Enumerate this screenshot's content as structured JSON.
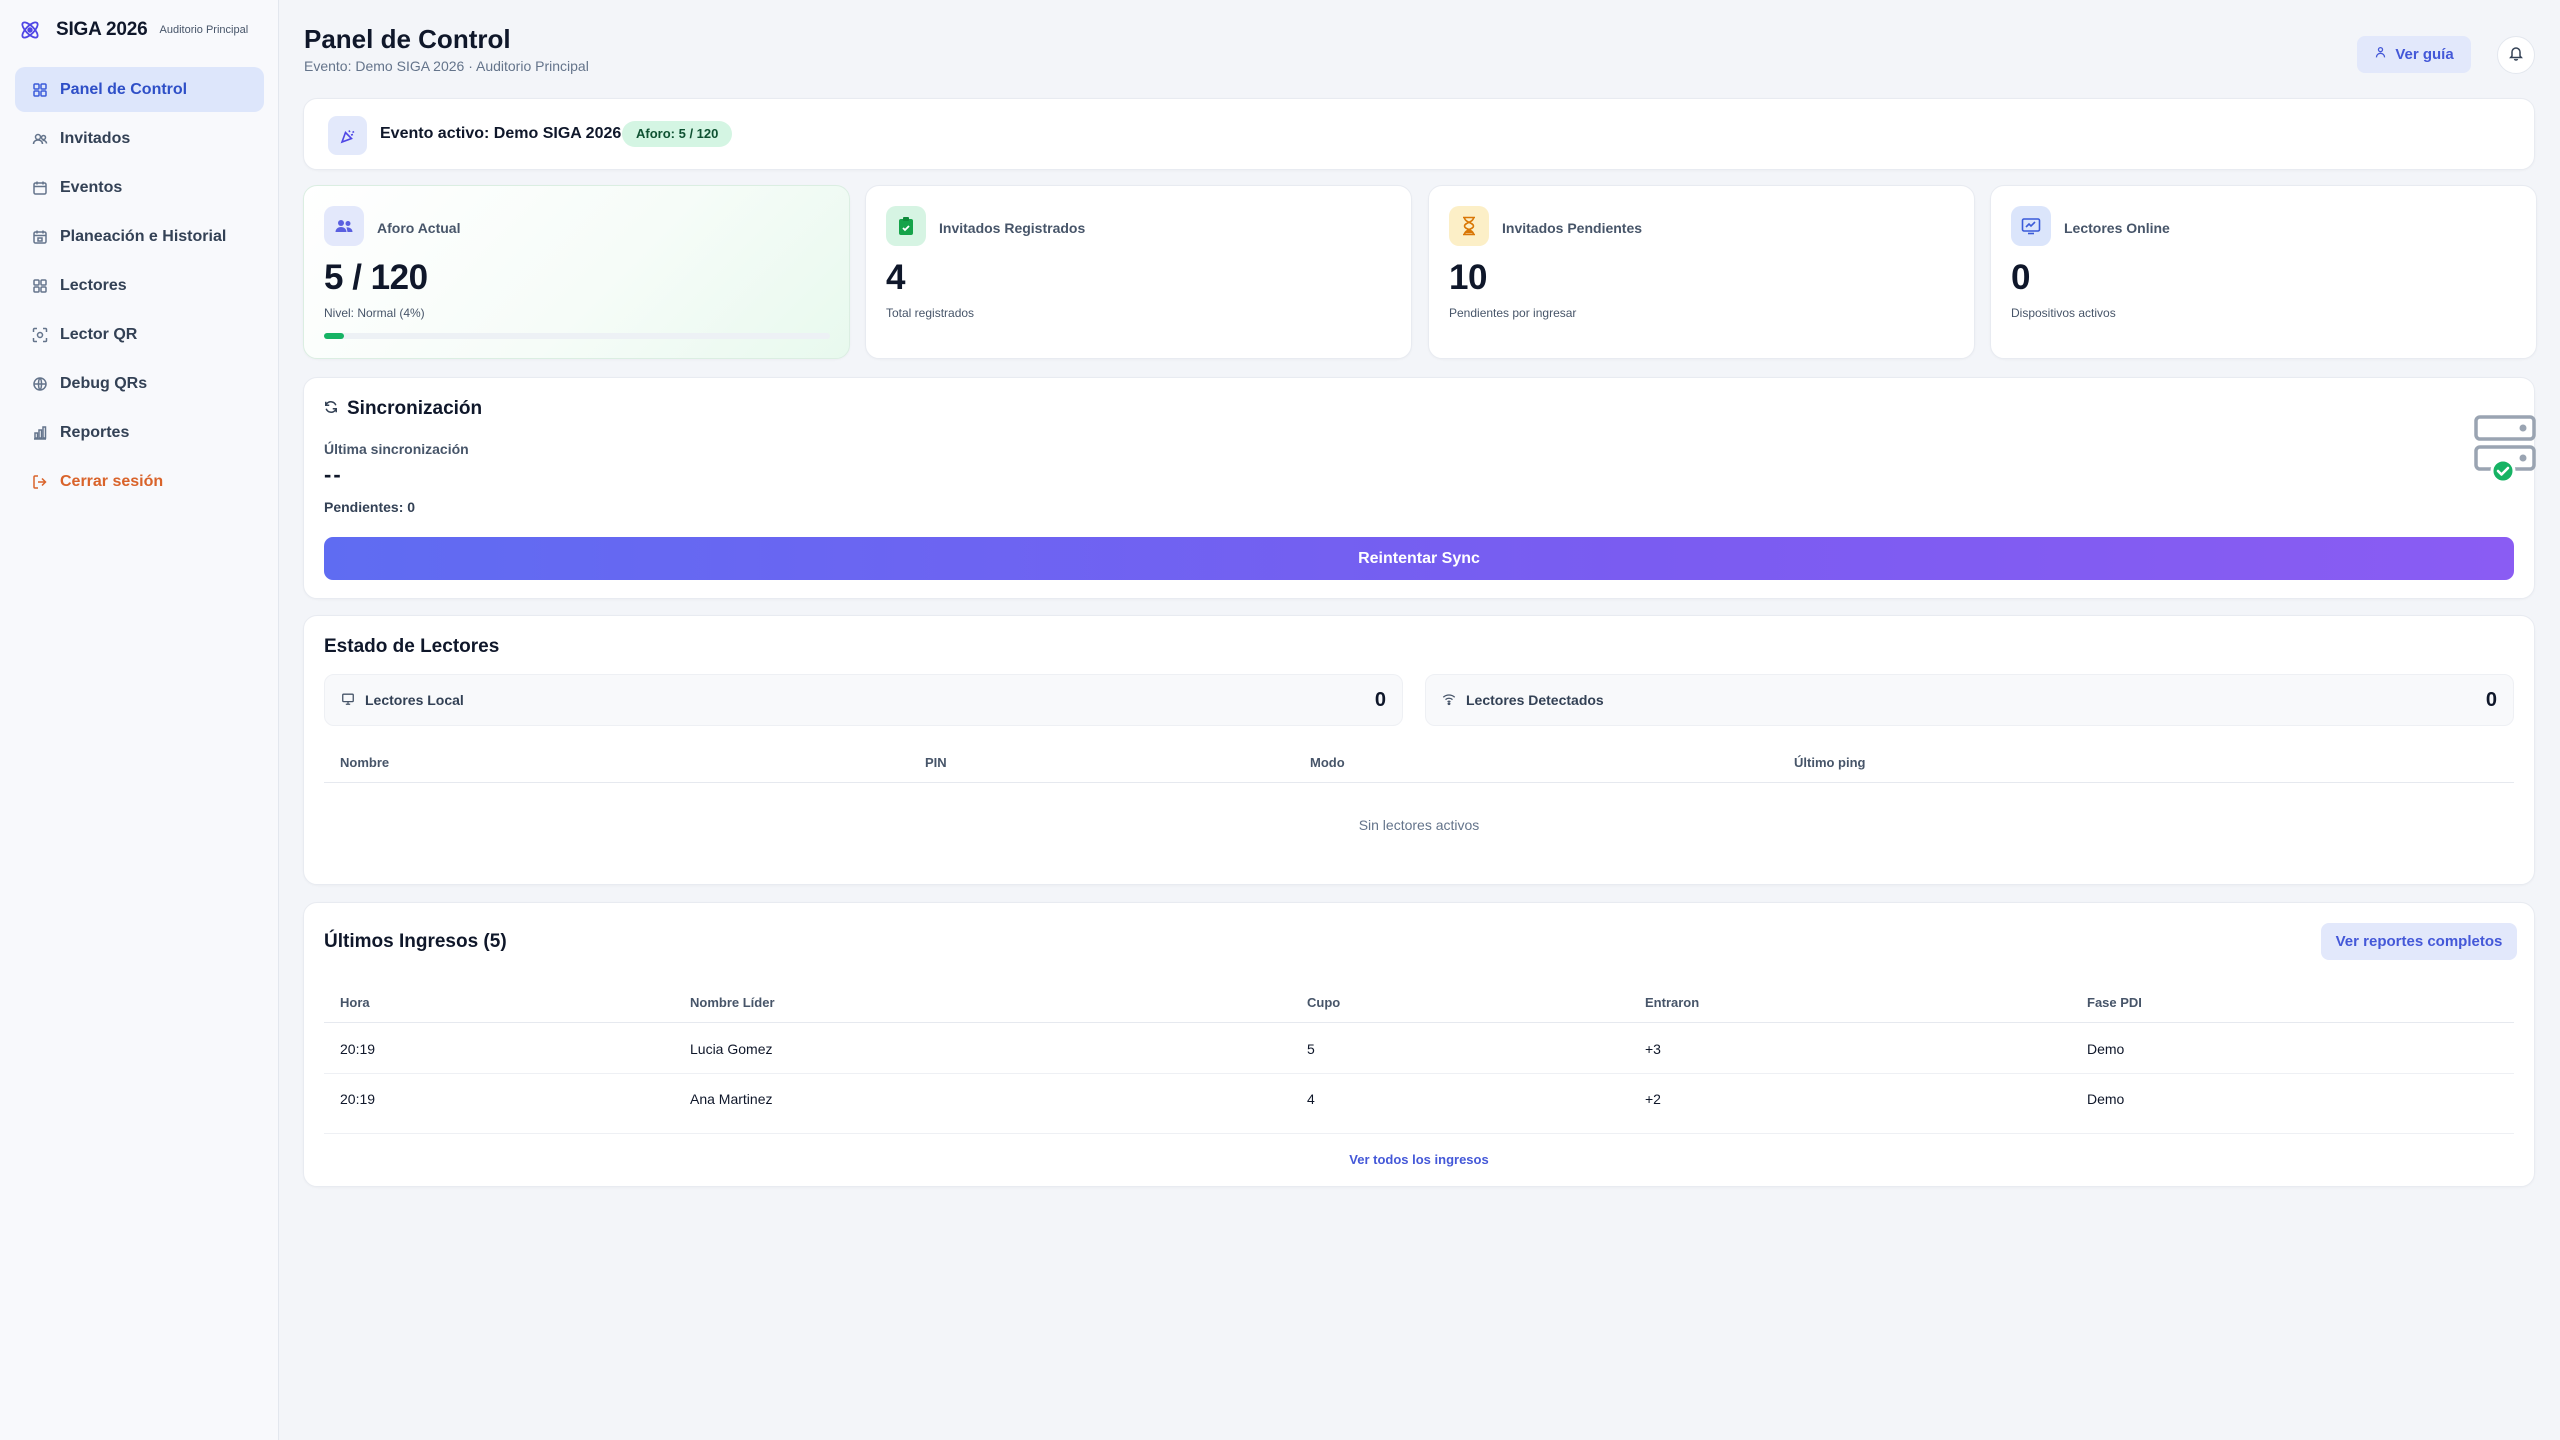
{
  "brand": {
    "name": "SIGA 2026",
    "subtitle": "Auditorio Principal"
  },
  "sidebar": {
    "items": [
      {
        "label": "Panel de Control",
        "icon": "grid-icon",
        "active": true
      },
      {
        "label": "Invitados",
        "icon": "users-icon"
      },
      {
        "label": "Eventos",
        "icon": "calendar-icon"
      },
      {
        "label": "Planeación e Historial",
        "icon": "calendar-history-icon"
      },
      {
        "label": "Lectores",
        "icon": "grid-icon"
      },
      {
        "label": "Lector QR",
        "icon": "qr-scan-icon"
      },
      {
        "label": "Debug QRs",
        "icon": "bug-icon"
      },
      {
        "label": "Reportes",
        "icon": "bar-chart-icon"
      },
      {
        "label": "Cerrar sesión",
        "icon": "logout-icon"
      }
    ]
  },
  "header": {
    "title": "Panel de Control",
    "subtitle": "Evento: Demo SIGA 2026 · Auditorio Principal",
    "guide_label": "Ver guía"
  },
  "event_banner": {
    "text": "Evento activo: Demo SIGA 2026",
    "badge": "Aforo: 5 / 120"
  },
  "stats": [
    {
      "label": "Aforo Actual",
      "value": "5 / 120",
      "sub": "Nivel: Normal (4%)",
      "icon": "users-icon",
      "progress": 0.04
    },
    {
      "label": "Invitados Registrados",
      "value": "4",
      "sub": "Total registrados",
      "icon": "clipboard-icon"
    },
    {
      "label": "Invitados Pendientes",
      "value": "10",
      "sub": "Pendientes por ingresar",
      "icon": "hourglass-icon"
    },
    {
      "label": "Lectores Online",
      "value": "0",
      "sub": "Dispositivos activos",
      "icon": "monitor-icon"
    }
  ],
  "sync": {
    "title": "Sincronización",
    "last_label": "Última sincronización",
    "last_value": "--",
    "pending": "Pendientes: 0",
    "button": "Reintentar Sync"
  },
  "readers": {
    "title": "Estado de Lectores",
    "local_label": "Lectores Local",
    "local_value": "0",
    "detected_label": "Lectores Detectados",
    "detected_value": "0",
    "columns": [
      "Nombre",
      "PIN",
      "Modo",
      "Último ping"
    ],
    "empty": "Sin lectores activos"
  },
  "entries": {
    "title": "Últimos Ingresos (5)",
    "reports_button": "Ver reportes completos",
    "columns": [
      "Hora",
      "Nombre Líder",
      "Cupo",
      "Entraron",
      "Fase PDI"
    ],
    "rows": [
      [
        "20:19",
        "Lucia Gomez",
        "5",
        "+3",
        "Demo"
      ],
      [
        "20:19",
        "Ana Martinez",
        "4",
        "+2",
        "Demo"
      ]
    ],
    "view_all": "Ver todos los ingresos"
  },
  "colors": {
    "accent": "#3b5bd9",
    "success": "#16b364",
    "logout": "#d9632a",
    "sync_gradient_start": "#5f6cf2",
    "sync_gradient_end": "#8a5cf3"
  }
}
